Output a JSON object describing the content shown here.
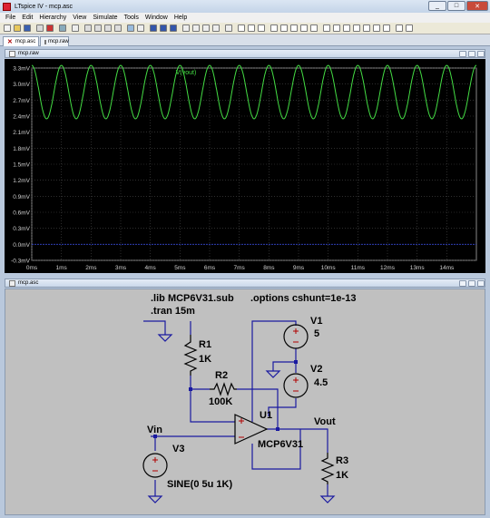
{
  "window": {
    "title": "LTspice IV - mcp.asc",
    "controls": [
      "_",
      "□",
      "✕"
    ]
  },
  "menu": [
    "File",
    "Edit",
    "Hierarchy",
    "View",
    "Simulate",
    "Tools",
    "Window",
    "Help"
  ],
  "tabs": [
    {
      "label": "mcp.asc",
      "active": true
    },
    {
      "label": "mcp.raw",
      "active": false
    }
  ],
  "plot_window": {
    "title": "mcp.raw"
  },
  "schematic_window": {
    "title": "mcp.asc"
  },
  "chart_data": {
    "type": "line",
    "series": [
      {
        "name": "V(vout)",
        "color": "#44dd44",
        "waveform": "sine",
        "offset_mV": 2.85,
        "amplitude_mV": 0.5,
        "frequency_hz": 1000
      }
    ],
    "series_labels_color": "#2255ff",
    "y_ticks": [
      "3.3mV",
      "3.0mV",
      "2.7mV",
      "2.4mV",
      "2.1mV",
      "1.8mV",
      "1.5mV",
      "1.2mV",
      "0.9mV",
      "0.6mV",
      "0.3mV",
      "0.0mV",
      "-0.3mV"
    ],
    "x_ticks": [
      "0ms",
      "1ms",
      "2ms",
      "3ms",
      "4ms",
      "5ms",
      "6ms",
      "7ms",
      "8ms",
      "9ms",
      "10ms",
      "11ms",
      "12ms",
      "13ms",
      "14ms"
    ],
    "xlim_ms": [
      0,
      15
    ],
    "ylim_mV": [
      -0.3,
      3.3
    ],
    "grid": true,
    "grid_color": "#4a4a4a",
    "background": "#000000",
    "zero_line_color": "#3344cc"
  },
  "schematic": {
    "directives": [
      ".lib MCP6V31.sub",
      ".tran 15m",
      ".options cshunt=1e-13"
    ],
    "components": [
      {
        "ref": "R1",
        "value": "1K"
      },
      {
        "ref": "R2",
        "value": "100K"
      },
      {
        "ref": "R3",
        "value": "1K"
      },
      {
        "ref": "V1",
        "value": "5"
      },
      {
        "ref": "V2",
        "value": "4.5"
      },
      {
        "ref": "V3",
        "value": "SINE(0 5u 1K)"
      },
      {
        "ref": "U1",
        "value": "MCP6V31"
      }
    ],
    "nets": [
      "Vin",
      "Vout"
    ],
    "wire_color": "#1a1aa0",
    "symbol_color": "#b00000",
    "background": "#c0c0c0"
  }
}
